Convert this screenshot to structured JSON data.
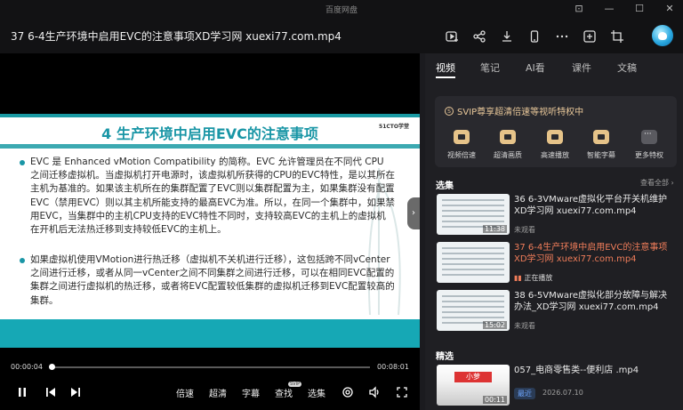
{
  "app": {
    "name": "百度网盘"
  },
  "header": {
    "file_title": "37 6-4生产环境中启用EVC的注意事项XD学习网 xuexi77.com.mp4"
  },
  "video": {
    "slide_title": "4 生产环境中启用EVC的注意事项",
    "slide_logo": "51CTO学堂",
    "bullet1": "EVC 是 Enhanced vMotion Compatibility 的简称。EVC 允许管理员在不同代 CPU 之间迁移虚拟机。当虚拟机打开电源时，该虚拟机所获得的CPU的EVC特性，是以其所在主机为基准的。如果该主机所在的集群配置了EVC则以集群配置为主，如果集群没有配置EVC（禁用EVC）则以其主机所能支持的最高EVC为准。所以，在同一个集群中，如果禁用EVC，当集群中的主机CPU支持的EVC特性不同时，支持较高EVC的主机上的虚拟机在开机后无法热迁移到支持较低EVC的主机上。",
    "bullet2": "如果虚拟机使用VMotion进行热迁移（虚拟机不关机进行迁移），这包括跨不同vCenter之间进行迁移，或者从同一vCenter之间不同集群之间进行迁移，可以在相同EVC配置的集群之间进行虚拟机的热迁移，或者将EVC配置较低集群的虚拟机迁移到EVC配置较高的集群。",
    "current_time": "00:00:04",
    "total_time": "00:08:01",
    "progress": 0.008
  },
  "controls": {
    "speed": "倍速",
    "quality": "超清",
    "subtitle": "字幕",
    "search": "查找",
    "search_badge": "SVIP",
    "episodes": "选集"
  },
  "panel": {
    "tabs": [
      "视频",
      "笔记",
      "AI看",
      "课件",
      "文稿"
    ],
    "svip_title": "SVIP尊享超清倍速等视听特权中",
    "features": [
      "视频倍速",
      "超清画质",
      "高速播放",
      "智能字幕",
      "更多特权"
    ],
    "episodes_label": "选集",
    "view_all": "查看全部 ›",
    "episodes": [
      {
        "title": "36 6-3VMware虚拟化平台开关机维护XD学习网 xuexi77.com.mp4",
        "duration": "11:38",
        "status": "未观看"
      },
      {
        "title": "37 6-4生产环境中启用EVC的注意事项XD学习网 xuexi77.com.mp4",
        "duration": "",
        "status": "正在播放"
      },
      {
        "title": "38 6-5VMware虚拟化部分故障与解决办法_XD学习网 xuexi77.com.mp4",
        "duration": "15:02",
        "status": "未观看"
      }
    ],
    "featured_label": "精选",
    "featured": {
      "title": "057_电商零售类--便利店 .mp4",
      "duration": "00:11",
      "badge": "最近",
      "date": "2026.07.10",
      "sign": "小萝"
    }
  }
}
